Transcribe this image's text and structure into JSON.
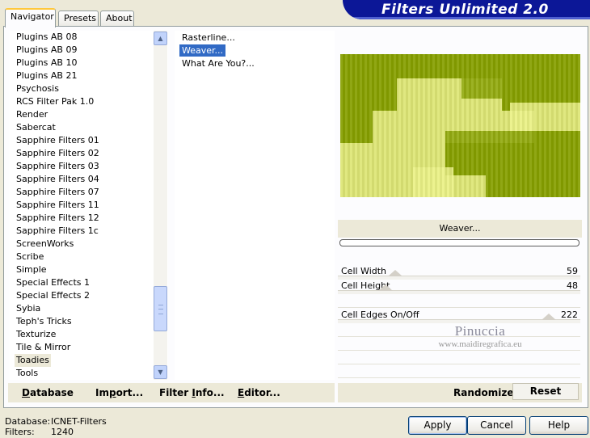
{
  "window": {
    "banner_title": "Filters Unlimited 2.0"
  },
  "tabs": [
    {
      "label": "Navigator",
      "active": true
    },
    {
      "label": "Presets",
      "active": false
    },
    {
      "label": "About",
      "active": false
    }
  ],
  "categories": {
    "items": [
      "Plugins AB 08",
      "Plugins AB 09",
      "Plugins AB 10",
      "Plugins AB 21",
      "Psychosis",
      "RCS Filter Pak 1.0",
      "Render",
      "Sabercat",
      "Sapphire Filters 01",
      "Sapphire Filters 02",
      "Sapphire Filters 03",
      "Sapphire Filters 04",
      "Sapphire Filters 07",
      "Sapphire Filters 11",
      "Sapphire Filters 12",
      "Sapphire Filters 1c",
      "ScreenWorks",
      "Scribe",
      "Simple",
      "Special Effects 1",
      "Special Effects 2",
      "Sybia",
      "Teph's Tricks",
      "Texturize",
      "Tile & Mirror",
      "Toadies",
      "Tools"
    ],
    "selected": "Toadies"
  },
  "filters": {
    "items": [
      "Rasterline...",
      "Weaver...",
      "What Are You?..."
    ],
    "selected": "Weaver..."
  },
  "preview": {
    "filter_name": "Weaver...",
    "colors": {
      "dark": "#87a000",
      "light": "#ecf28a"
    }
  },
  "params": [
    {
      "label": "Cell Width",
      "value": "59"
    },
    {
      "label": "Cell Height",
      "value": "48"
    },
    {
      "label": "Cell Edges On/Off",
      "value": "222"
    }
  ],
  "watermark": {
    "name": "Pinuccia",
    "url": "www.maidiregrafica.eu"
  },
  "tab_buttons": {
    "database": {
      "hot": "D",
      "rest": "atabase"
    },
    "import": {
      "pre": "Im",
      "hot": "p",
      "rest": "ort..."
    },
    "filter_info": {
      "pre": "Filter ",
      "hot": "I",
      "rest": "nfo..."
    },
    "editor": {
      "hot": "E",
      "rest": "ditor..."
    },
    "randomize": "Randomize",
    "reset": "Reset"
  },
  "footer": {
    "database_label": "Database:",
    "database_value": "ICNET-Filters",
    "filters_label": "Filters:",
    "filters_value": "1240",
    "apply": "Apply",
    "cancel": "Cancel",
    "help": "Help"
  }
}
